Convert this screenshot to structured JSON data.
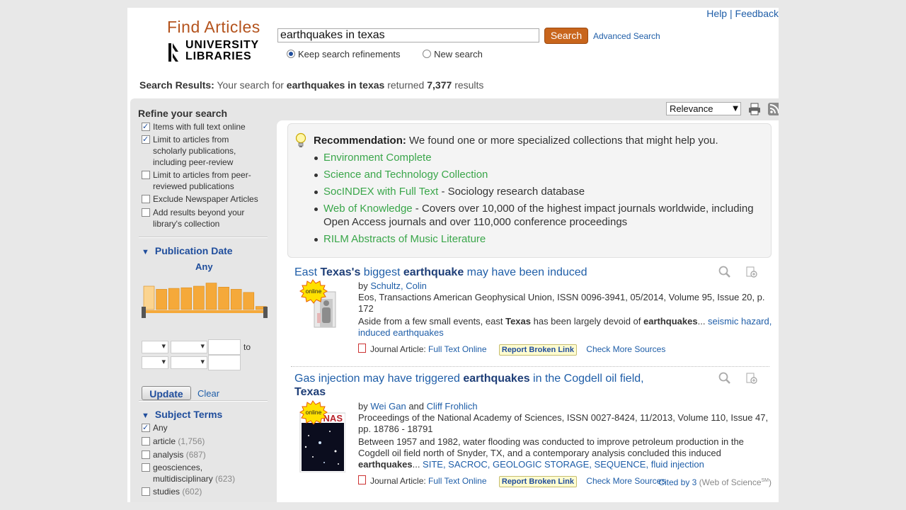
{
  "header": {
    "help_label": "Help",
    "feedback_label": "Feedback",
    "logo_title": "Find Articles",
    "logo_line1": "UNIVERSITY",
    "logo_line2": "LIBRARIES"
  },
  "search": {
    "query": "earthquakes in texas",
    "button_label": "Search",
    "advanced_label": "Advanced Search",
    "radio_keep": "Keep search refinements",
    "radio_new": "New search",
    "selected_radio": "keep"
  },
  "results_summary": {
    "label": "Search Results:",
    "prefix": "Your search for",
    "query": "earthquakes in texas",
    "middle": "returned",
    "count": "7,377",
    "suffix": "results"
  },
  "sidebar": {
    "refine_title": "Refine your search",
    "options": [
      {
        "label": "Items with full text online",
        "checked": true
      },
      {
        "label": "Limit to articles from scholarly publications, including peer-review",
        "checked": true
      },
      {
        "label": "Limit to articles from peer-reviewed publications",
        "checked": false
      },
      {
        "label": "Exclude Newspaper Articles",
        "checked": false
      },
      {
        "label": "Add results beyond your library's collection",
        "checked": false
      }
    ],
    "pub_date_title": "Publication Date",
    "pub_date_value": "Any",
    "histogram": [
      0.75,
      0.65,
      0.68,
      0.7,
      0.75,
      0.85,
      0.72,
      0.65,
      0.55,
      0.1
    ],
    "date_to_label": "to",
    "update_label": "Update",
    "clear_label": "Clear",
    "subject_title": "Subject Terms",
    "subjects": [
      {
        "label": "Any",
        "count": "",
        "checked": true
      },
      {
        "label": "article",
        "count": "(1,756)",
        "checked": false
      },
      {
        "label": "analysis",
        "count": "(687)",
        "checked": false
      },
      {
        "label": "geosciences, multidisciplinary",
        "count": "(623)",
        "checked": false
      },
      {
        "label": "studies",
        "count": "(602)",
        "checked": false
      }
    ]
  },
  "sort": {
    "selected": "Relevance"
  },
  "recommendation": {
    "label": "Recommendation:",
    "text": "We found one or more specialized collections that might help you.",
    "items": [
      {
        "link": "Environment Complete",
        "desc": ""
      },
      {
        "link": "Science and Technology Collection",
        "desc": ""
      },
      {
        "link": "SocINDEX with Full Text",
        "desc": " - Sociology research database"
      },
      {
        "link": "Web of Knowledge",
        "desc": " - Covers over 10,000 of the highest impact journals worldwide, including Open Access journals and over 110,000 conference proceedings"
      },
      {
        "link": "RILM Abstracts of Music Literature",
        "desc": ""
      }
    ]
  },
  "results": [
    {
      "title_parts": [
        "East ",
        "Texas's",
        " biggest ",
        "earthquake",
        " may have been induced"
      ],
      "by_label": "by",
      "authors": [
        "Schultz, Colin"
      ],
      "source": "Eos, Transactions American Geophysical Union, ISSN 0096-3941, 05/2014, Volume 95, Issue 20, p. 172",
      "abstract_parts": [
        "Aside from a few small events, east ",
        "Texas",
        " has been largely devoid of ",
        "earthquakes",
        "... "
      ],
      "subject_links": "seismic hazard, induced earthquakes",
      "badge": "online",
      "format_label": "Journal Article:",
      "fulltext_label": "Full Text Online",
      "broken_label": "Report Broken Link",
      "more_sources": "Check More Sources"
    },
    {
      "title_parts": [
        "Gas injection may have triggered ",
        "earthquakes",
        " in the Cogdell oil field, ",
        "Texas",
        ""
      ],
      "by_label": "by",
      "authors": [
        "Wei Gan",
        "Cliff Frohlich"
      ],
      "and_label": "and",
      "source": "Proceedings of the National Academy of Sciences, ISSN 0027-8424, 11/2013, Volume 110, Issue 47, pp. 18786 - 18791",
      "abstract_parts": [
        "Between 1957 and 1982, water flooding was conducted to improve petroleum production in the Cogdell oil field north of Snyder, TX, and a contemporary analysis concluded this induced ",
        "earthquakes",
        "... "
      ],
      "subject_links": "SITE, SACROC, GEOLOGIC STORAGE, SEQUENCE, fluid injection",
      "badge": "online",
      "thumb_text": "PNAS",
      "format_label": "Journal Article:",
      "fulltext_label": "Full Text Online",
      "broken_label": "Report Broken Link",
      "more_sources": "Check More Sources",
      "cited_label": "Cited by 3",
      "cited_suffix": "(Web of Science",
      "cited_mark": "SM",
      "cited_close": ")"
    }
  ],
  "colors": {
    "brand_orange": "#c8651c",
    "link_blue": "#1f5ea8",
    "rec_green": "#3aa64a",
    "histogram_orange": "#f5a93a"
  }
}
